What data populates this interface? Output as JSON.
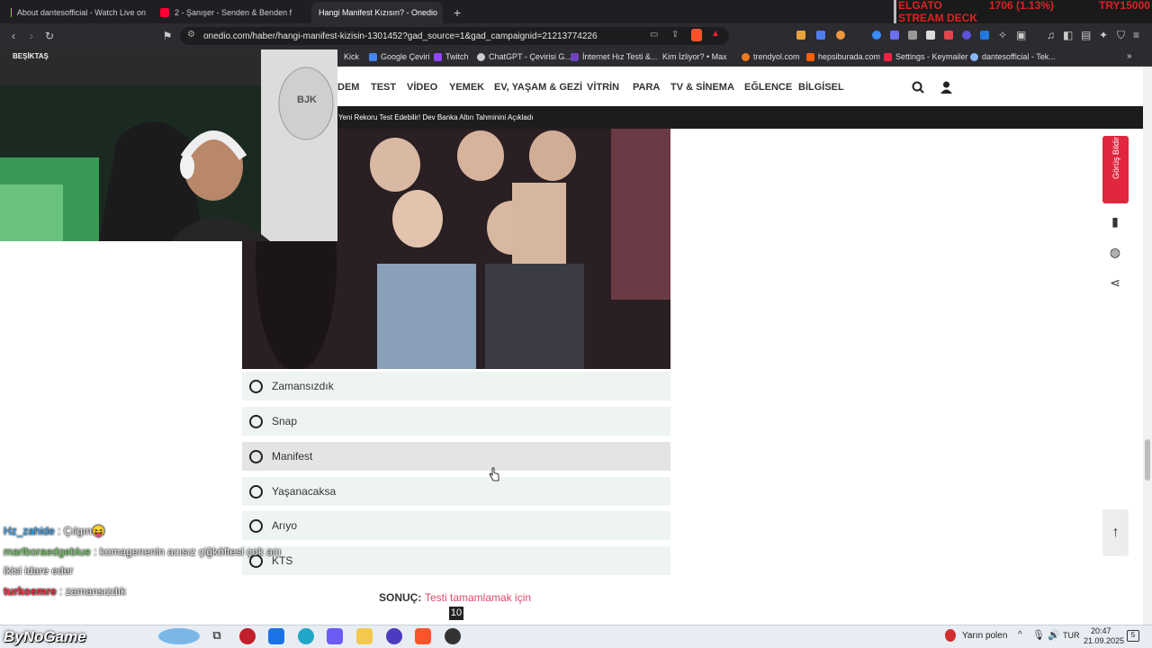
{
  "tabs": [
    {
      "title": "About dantesofficial - Watch Live on",
      "icon_color": "#53fc18",
      "icon": "kick-icon"
    },
    {
      "title": "2 - Şanışer - Senden & Benden f",
      "icon_color": "#ff0033",
      "icon": "youtube-icon"
    },
    {
      "title": "Hangi Manifest Kızısın? - Onedio",
      "icon_color": "#ffffff",
      "icon": "onedio-icon"
    }
  ],
  "new_tab_label": "+",
  "url": "onedio.com/haber/hangi-manifest-kizisin-1301452?gad_source=1&gad_campaignid=21213774226",
  "stream_overlay": {
    "line1": "ELGATO",
    "line2": "STREAM DECK",
    "stat": "1706 (1.13%)",
    "price": "TRY15000"
  },
  "bookmarks": [
    {
      "label": "Kick",
      "color": "#53fc18"
    },
    {
      "label": "Google Çeviri",
      "color": "#4285f4"
    },
    {
      "label": "Twitch",
      "color": "#9146ff"
    },
    {
      "label": "ChatGPT - Çevirisi G...",
      "color": "#cccccc"
    },
    {
      "label": "İnternet Hız Testi &...",
      "color": "#6f42c1"
    },
    {
      "label": "Kim İzliyor? • Max",
      "color": "#ffffff"
    },
    {
      "label": "trendyol.com",
      "color": "#f27a1a"
    },
    {
      "label": "hepsiburada.com",
      "color": "#ff6000"
    },
    {
      "label": "Settings - Keymailer",
      "color": "#ff2244"
    },
    {
      "label": "dantesofficial - Tek...",
      "color": "#8ab4f8"
    }
  ],
  "nav": {
    "items": [
      "DEM",
      "TEST",
      "VİDEO",
      "YEMEK",
      "EV, YAŞAM & GEZİ",
      "VİTRİN",
      "PARA",
      "TV & SİNEMA",
      "EĞLENCE",
      "BİLGİSEL"
    ]
  },
  "ticker": "Yeni Rekoru Test Edebilir! Dev Banka Altın Tahminini Açıkladı",
  "webcam": {
    "banner": "BEŞİKTAŞ",
    "crest": "BJK"
  },
  "options": [
    "Zamansızdık",
    "Snap",
    "Manifest",
    "Yaşanacaksa",
    "Arıyo",
    "KTS"
  ],
  "result": {
    "label": "SONUÇ:",
    "value": "Testi tamamlamak için",
    "badge": "10"
  },
  "rail": {
    "feedback_label": "Görüş Bildir"
  },
  "chat": [
    {
      "user": "Hz_zahide",
      "user_color": "#33aaff",
      "message": ": Çılgın😝"
    },
    {
      "user": "marlboraedgeblue",
      "user_color": "#7bd96a",
      "message": ": komagenenin acısız çiğköftesi çok acı"
    },
    {
      "user": "",
      "user_color": "#ffffff",
      "message": "ikisi idare eder"
    },
    {
      "user": "turkoemre",
      "user_color": "#ff3344",
      "message": ": zamansızdık"
    }
  ],
  "watermark": "ByNoGame",
  "taskbar": {
    "weather": "Yarın polen",
    "lang": "TUR",
    "time": "20:47",
    "date": "21.09.2025",
    "notif": "5"
  },
  "colors": {
    "accent": "#e1263e",
    "option_bg": "#eef5f1",
    "result_link": "#d94a6b"
  }
}
